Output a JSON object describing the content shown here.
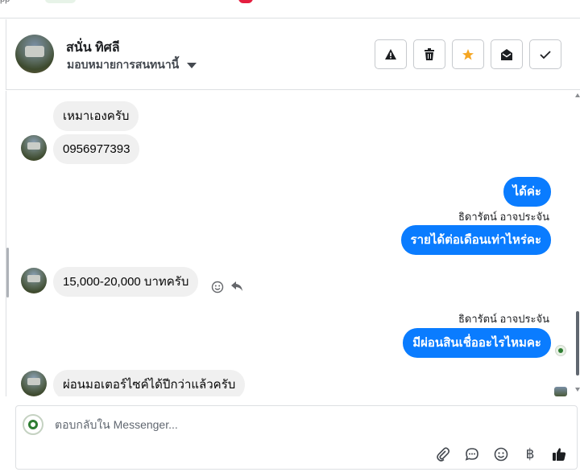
{
  "top_strip": {
    "fragment": "pp"
  },
  "header": {
    "contact_name": "สนั่น ทิศลี",
    "assign_label": "มอบหมายการสนทนานี้",
    "buttons": [
      {
        "name": "report-button",
        "icon": "warning-icon"
      },
      {
        "name": "delete-button",
        "icon": "trash-icon"
      },
      {
        "name": "star-button",
        "icon": "star-icon"
      },
      {
        "name": "mark-unread-button",
        "icon": "envelope-open-icon"
      },
      {
        "name": "mark-done-button",
        "icon": "check-icon"
      }
    ],
    "accent_star": "#f5a623"
  },
  "messages": [
    {
      "dir": "in",
      "text": "เหมาเองครับ"
    },
    {
      "dir": "in",
      "text": "0956977393"
    },
    {
      "dir": "out",
      "text": "ได้ค่ะ"
    },
    {
      "dir": "out",
      "sender": "ธิดารัตน์ อาจประจัน",
      "text": "รายได้ต่อเดือนเท่าไหร่คะ"
    },
    {
      "dir": "in",
      "text": "15,000-20,000 บาทครับ"
    },
    {
      "dir": "out",
      "sender": "ธิดารัตน์ อาจประจัน",
      "text": "มีผ่อนสินเชื่ออะไรไหมคะ"
    },
    {
      "dir": "in",
      "text": "ผ่อนมอเตอร์ไซค์ได้ปีกว่าแล้วครับ"
    }
  ],
  "composer": {
    "placeholder": "ตอบกลับใน Messenger...",
    "tools": [
      "paperclip-icon",
      "chat-bubble-icon",
      "emoji-icon",
      "baht-icon",
      "thumbs-up-icon"
    ],
    "baht_glyph": "฿"
  },
  "colors": {
    "outgoing": "#0a7cff",
    "incoming": "#f0f0f0"
  }
}
